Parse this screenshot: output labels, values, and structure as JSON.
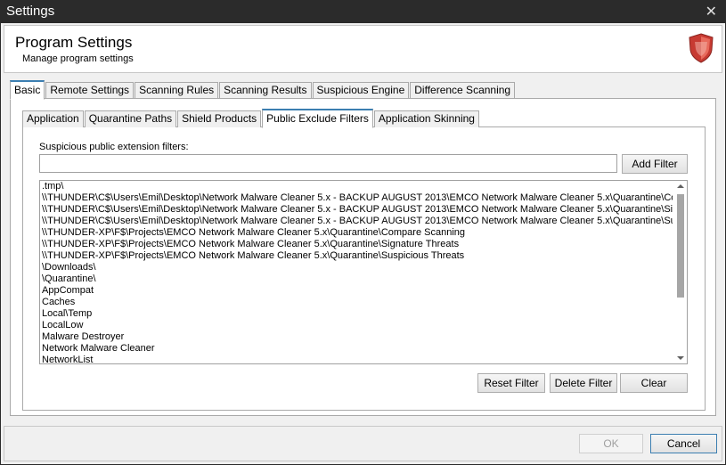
{
  "window": {
    "title": "Settings",
    "close_glyph": "✕"
  },
  "header": {
    "title": "Program Settings",
    "subtitle": "Manage program settings",
    "icon": "shield-icon",
    "accent_color": "#d9443a"
  },
  "main_tabs": [
    {
      "label": "Basic",
      "active": true
    },
    {
      "label": "Remote Settings",
      "active": false
    },
    {
      "label": "Scanning Rules",
      "active": false
    },
    {
      "label": "Scanning Results",
      "active": false
    },
    {
      "label": "Suspicious Engine",
      "active": false
    },
    {
      "label": "Difference Scanning",
      "active": false
    }
  ],
  "sub_tabs": [
    {
      "label": "Application",
      "active": false
    },
    {
      "label": "Quarantine Paths",
      "active": false
    },
    {
      "label": "Shield Products",
      "active": false
    },
    {
      "label": "Public Exclude Filters",
      "active": true
    },
    {
      "label": "Application Skinning",
      "active": false
    }
  ],
  "filters": {
    "label": "Suspicious public extension filters:",
    "input_value": "",
    "add_button": "Add Filter",
    "items": [
      ".tmp\\",
      "\\\\THUNDER\\C$\\Users\\Emil\\Desktop\\Network Malware Cleaner 5.x - BACKUP AUGUST 2013\\EMCO Network Malware Cleaner 5.x\\Quarantine\\Cor",
      "\\\\THUNDER\\C$\\Users\\Emil\\Desktop\\Network Malware Cleaner 5.x - BACKUP AUGUST 2013\\EMCO Network Malware Cleaner 5.x\\Quarantine\\Sig",
      "\\\\THUNDER\\C$\\Users\\Emil\\Desktop\\Network Malware Cleaner 5.x - BACKUP AUGUST 2013\\EMCO Network Malware Cleaner 5.x\\Quarantine\\Sus",
      "\\\\THUNDER-XP\\F$\\Projects\\EMCO Network Malware Cleaner 5.x\\Quarantine\\Compare Scanning",
      "\\\\THUNDER-XP\\F$\\Projects\\EMCO Network Malware Cleaner 5.x\\Quarantine\\Signature Threats",
      "\\\\THUNDER-XP\\F$\\Projects\\EMCO Network Malware Cleaner 5.x\\Quarantine\\Suspicious Threats",
      "\\Downloads\\",
      "\\Quarantine\\",
      "AppCompat",
      "Caches",
      "Local\\Temp",
      "LocalLow",
      "Malware Destroyer",
      "Network Malware Cleaner",
      "NetworkList"
    ],
    "reset_button": "Reset Filter",
    "delete_button": "Delete Filter",
    "clear_button": "Clear"
  },
  "footer": {
    "ok_button": "OK",
    "cancel_button": "Cancel"
  }
}
